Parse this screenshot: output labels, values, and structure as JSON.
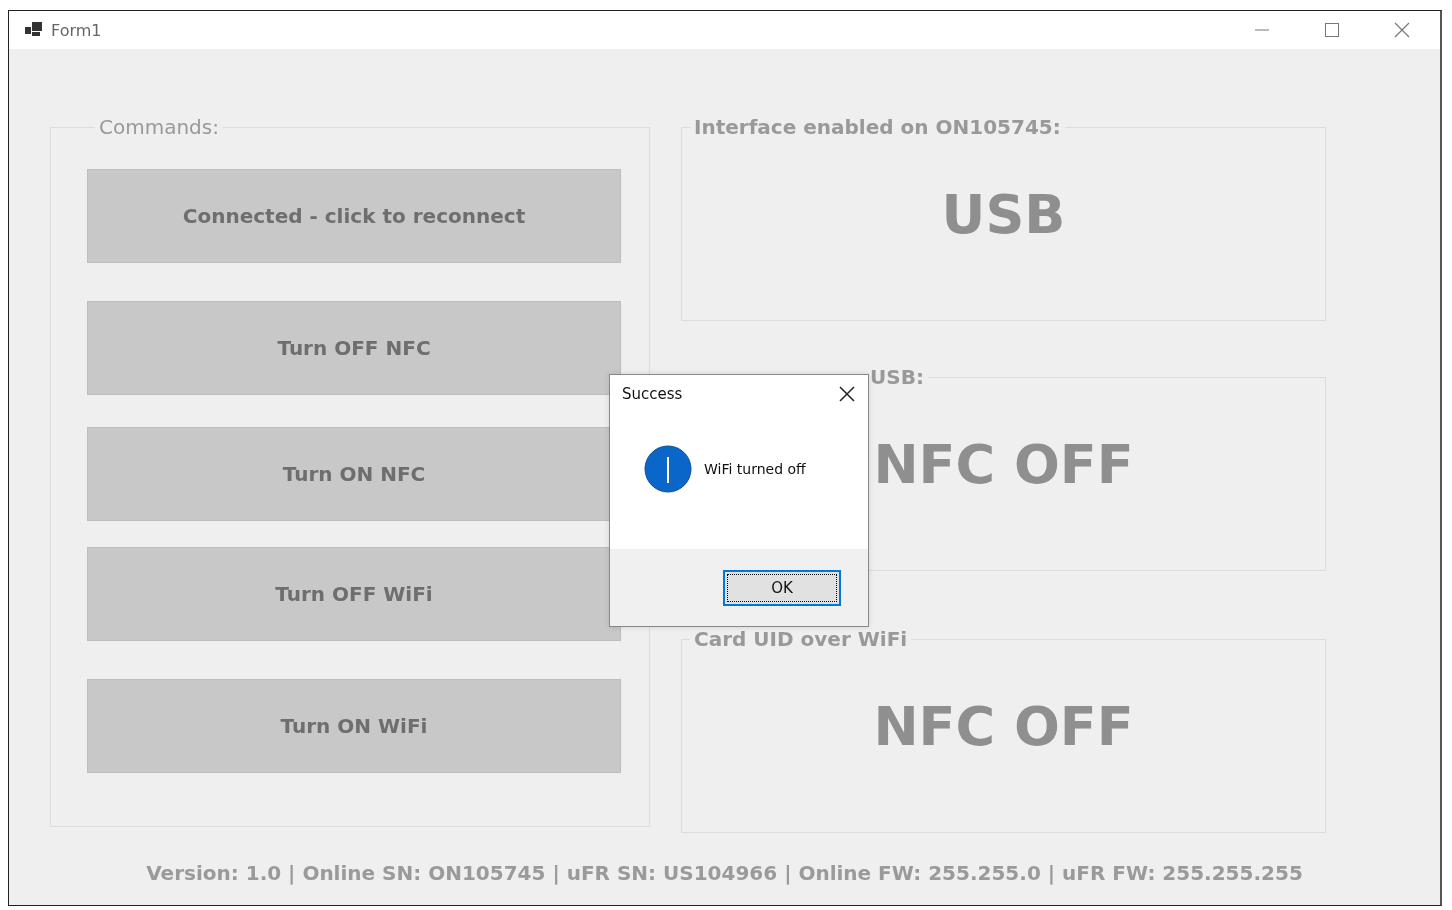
{
  "window": {
    "title": "Form1"
  },
  "commands": {
    "title": "Commands:",
    "buttons": [
      {
        "label": "Connected - click to reconnect",
        "disabled": true
      },
      {
        "label": "Turn OFF NFC",
        "disabled": true
      },
      {
        "label": "Turn ON NFC",
        "disabled": true
      },
      {
        "label": "Turn OFF WiFi",
        "disabled": true
      },
      {
        "label": "Turn ON WiFi",
        "disabled": true
      }
    ]
  },
  "panels": [
    {
      "title": "Interface enabled on ON105745:",
      "value": "USB"
    },
    {
      "title": "USB:",
      "value": "NFC OFF"
    },
    {
      "title": "Card UID over WiFi",
      "value": "NFC OFF"
    }
  ],
  "status_bar": "Version: 1.0 | Online SN: ON105745 | uFR SN: US104966 | Online FW: 255.255.0 | uFR FW: 255.255.255",
  "dialog": {
    "title": "Success",
    "message": "WiFi turned off",
    "button": "OK"
  }
}
